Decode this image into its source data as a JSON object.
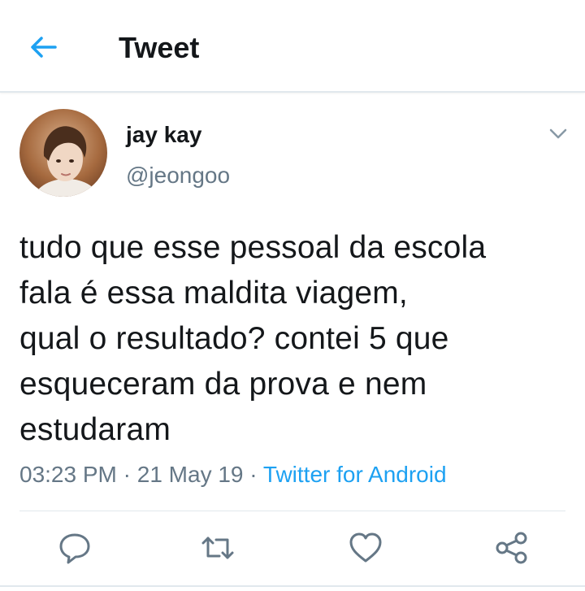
{
  "header": {
    "title": "Tweet",
    "back_icon": "arrow-left-icon",
    "accent_color": "#1da1f2"
  },
  "tweet": {
    "author": {
      "display_name": "jay kay",
      "handle": "@jeongoo",
      "avatar_icon": "user-avatar"
    },
    "menu_icon": "chevron-down-icon",
    "text": "tudo que esse pessoal da escola\nfala é essa maldita viagem,\nqual o resultado? contei 5 que\nesqueceram da prova e nem\nestudaram",
    "time": "03:23 PM",
    "separator": " · ",
    "date": "21 May 19",
    "source": "Twitter for Android"
  },
  "actions": [
    {
      "name": "reply",
      "icon": "reply-icon"
    },
    {
      "name": "retweet",
      "icon": "retweet-icon"
    },
    {
      "name": "like",
      "icon": "heart-icon"
    },
    {
      "name": "share",
      "icon": "share-icon"
    }
  ],
  "colors": {
    "text": "#14171a",
    "secondary": "#657786",
    "link": "#1da1f2",
    "border": "#e1e8ed"
  }
}
